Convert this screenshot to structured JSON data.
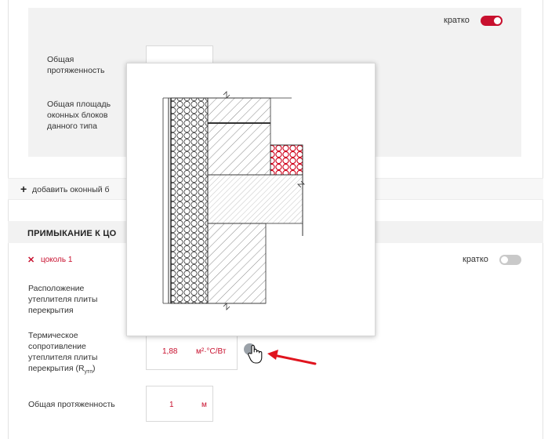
{
  "top_panel": {
    "toggle_label": "кратко",
    "toggle_state": "on",
    "field_length_label": "Общая протяженность",
    "field_area_label": "Общая площадь оконных блоков данного типа"
  },
  "add_window": {
    "label": "добавить оконный б"
  },
  "plinth_section": {
    "title": "ПРИМЫКАНИЕ К ЦО",
    "item_name": "цоколь 1",
    "toggle_label": "кратко",
    "toggle_state": "off",
    "field_location_label": "Расположение утеплителя плиты перекрытия",
    "field_resistance_label_main": "Термическое сопротивление утеплителя плиты перекрытия (R",
    "field_resistance_label_sub": "утп",
    "field_resistance_label_end": ")",
    "resistance_value": "1,88",
    "resistance_unit": "м²·°С/Вт",
    "field_length_label": "Общая протяженность",
    "length_value": "1",
    "length_unit": "м"
  },
  "colors": {
    "accent": "#c8102e",
    "panel_grey": "#f2f2f2"
  },
  "icons": [
    "plus-icon",
    "remove-x-icon",
    "info-icon",
    "hand-cursor-icon",
    "pointer-arrow-icon"
  ]
}
